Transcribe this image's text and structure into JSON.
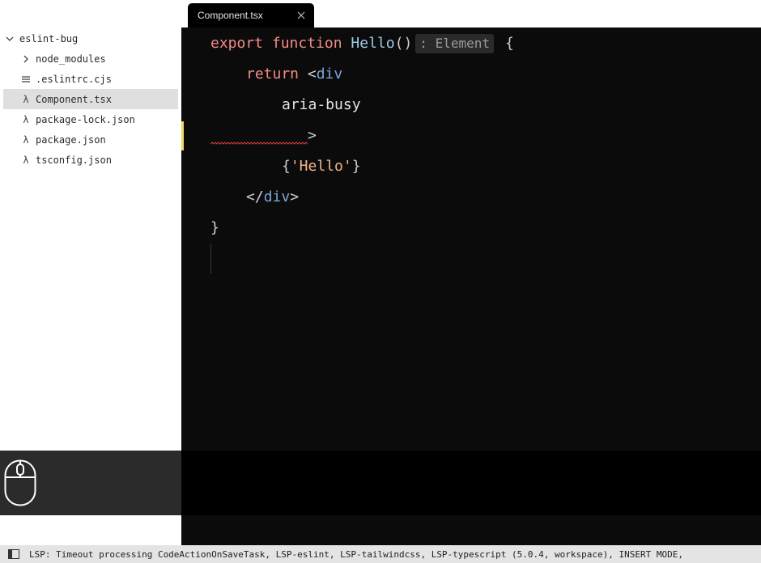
{
  "sidebar": {
    "root": {
      "label": "eslint-bug",
      "icon": "chevron-down-icon"
    },
    "items": [
      {
        "label": "node_modules",
        "icon": "chevron-right-icon"
      },
      {
        "label": ".eslintrc.cjs",
        "icon": "list-icon"
      },
      {
        "label": "Component.tsx",
        "icon": "lambda-icon",
        "selected": true
      },
      {
        "label": "package-lock.json",
        "icon": "lambda-icon"
      },
      {
        "label": "package.json",
        "icon": "lambda-icon"
      },
      {
        "label": "tsconfig.json",
        "icon": "lambda-icon"
      }
    ]
  },
  "tabs": [
    {
      "label": "Component.tsx",
      "active": true,
      "close_icon": "close-icon"
    }
  ],
  "editor": {
    "lines": {
      "l1": {
        "kw1": "export",
        "kw2": "function",
        "name": "Hello",
        "parens": "()",
        "type_hint": ": Element",
        "brace": "{"
      },
      "l2": {
        "kw": "return",
        "lt": "<",
        "tag": "div"
      },
      "l3": {
        "attr": "aria-busy"
      },
      "l4": {
        "gt": ">"
      },
      "l5": {
        "open": "{",
        "str": "'Hello'",
        "close": "}"
      },
      "l6": {
        "lt": "</",
        "tag": "div",
        "gt": ">"
      },
      "l7": {
        "brace": "}"
      }
    },
    "colors": {
      "keyword": "#f58b86",
      "function": "#9ecbe6",
      "tag": "#79a7d8",
      "string": "#f2b48a",
      "diagnostic_squiggle": "#d9413a",
      "modified_line_marker": "#e9d66b"
    }
  },
  "overlay": {
    "icon": "mouse-icon"
  },
  "status": {
    "text": "LSP: Timeout processing CodeActionOnSaveTask, LSP-eslint, LSP-tailwindcss, LSP-typescript (5.0.4, workspace), INSERT MODE,",
    "toggle_icon": "panel-toggle-icon"
  }
}
